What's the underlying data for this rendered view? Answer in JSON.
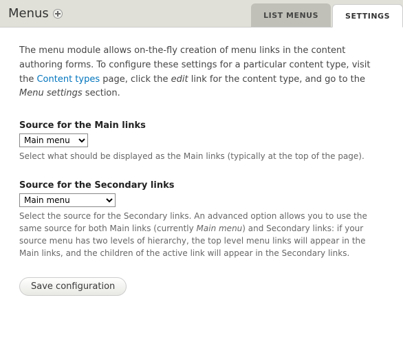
{
  "header": {
    "title": "Menus",
    "tabs": [
      {
        "label": "LIST MENUS"
      },
      {
        "label": "SETTINGS"
      }
    ]
  },
  "intro": {
    "part1": "The menu module allows on-the-fly creation of menu links in the content authoring forms. To configure these settings for a particular content type, visit the ",
    "link": "Content types",
    "part2": " page, click the ",
    "em1": "edit",
    "part3": " link for the content type, and go to the ",
    "em2": "Menu settings",
    "part4": " section."
  },
  "fields": {
    "main": {
      "label": "Source for the Main links",
      "value": "Main menu",
      "description": "Select what should be displayed as the Main links (typically at the top of the page)."
    },
    "secondary": {
      "label": "Source for the Secondary links",
      "value": "Main menu",
      "desc_part1": "Select the source for the Secondary links. An advanced option allows you to use the same source for both Main links (currently ",
      "desc_em": "Main menu",
      "desc_part2": ") and Secondary links: if your source menu has two levels of hierarchy, the top level menu links will appear in the Main links, and the children of the active link will appear in the Secondary links."
    }
  },
  "actions": {
    "submit": "Save configuration"
  }
}
